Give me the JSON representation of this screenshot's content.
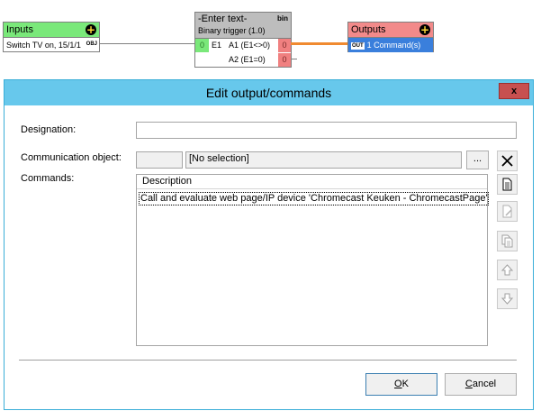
{
  "diagram": {
    "inputs": {
      "title": "Inputs",
      "row_label": "Switch TV on, 15/1/1",
      "row_badge": "OBJ"
    },
    "trigger": {
      "title": "-Enter text-",
      "subtitle": "Binary trigger (1.0)",
      "type_label": "bin",
      "in_value": "0",
      "in_label": "E1",
      "out1_label": "A1 (E1<>0)",
      "out1_value": "0",
      "out2_label": "A2 (E1=0)",
      "out2_value": "0"
    },
    "outputs": {
      "title": "Outputs",
      "row_badge": "OUT",
      "row_label": "1 Command(s)"
    },
    "colors": {
      "inputs_head": "#7ae87a",
      "outputs_head": "#f28a8a",
      "trigger_head": "#bdbdbd",
      "selected_row": "#3a7fdc",
      "wire_active": "#f08a30"
    }
  },
  "dialog": {
    "title": "Edit output/commands",
    "close_label": "x",
    "designation": {
      "label": "Designation:",
      "value": ""
    },
    "communication_object": {
      "label": "Communication object:",
      "code": "",
      "value": "[No selection]",
      "browse_label": "..."
    },
    "commands": {
      "label": "Commands:",
      "column_header": "Description",
      "rows": [
        "Call and evaluate web page/IP device 'Chromecast Keuken - ChromecastPage'"
      ]
    },
    "side_buttons": [
      {
        "icon": "clear-x-icon"
      },
      {
        "icon": "new-document-icon"
      },
      {
        "icon": "edit-document-icon"
      },
      {
        "icon": "copy-document-icon"
      },
      {
        "icon": "move-up-icon"
      },
      {
        "icon": "move-down-icon"
      }
    ],
    "ok": {
      "mnemonic": "O",
      "rest": "K"
    },
    "cancel": {
      "mnemonic": "C",
      "rest": "ancel"
    },
    "colors": {
      "titlebar": "#67c8ec",
      "close": "#c75050"
    }
  }
}
